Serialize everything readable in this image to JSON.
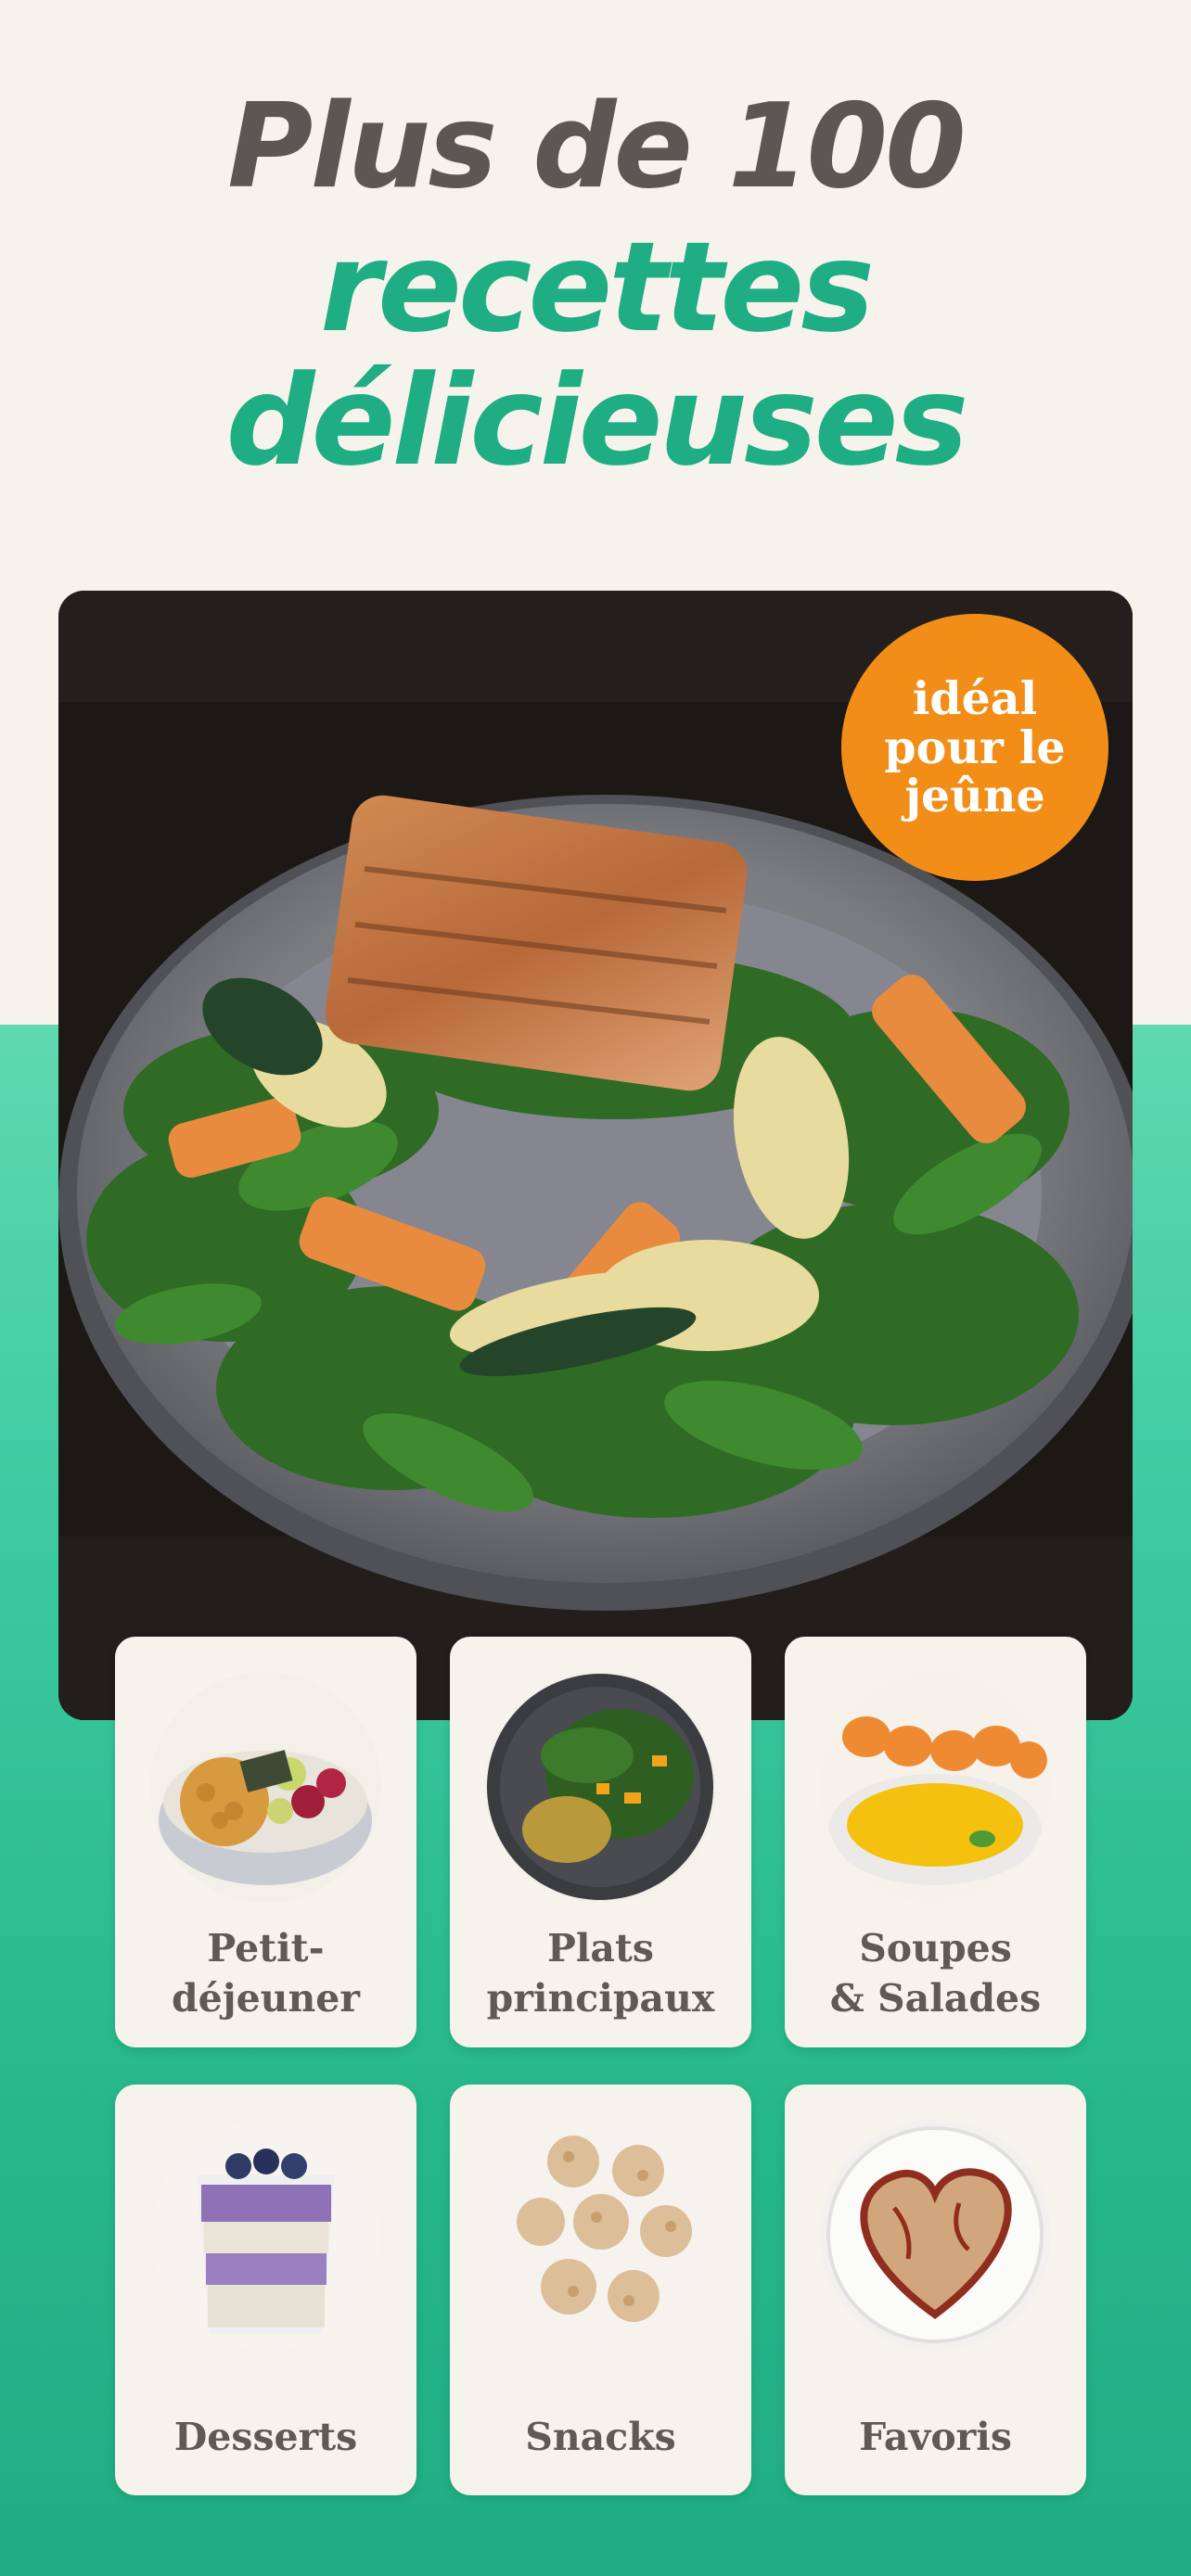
{
  "headline": {
    "line1": "Plus de 100",
    "line2": "recettes",
    "line3": "délicieuses"
  },
  "hero": {
    "image_icon": "salmon-salad-photo",
    "badge": {
      "line1": "idéal",
      "line2": "pour le",
      "line3": "jeûne",
      "color": "#f28e18"
    }
  },
  "categories": [
    {
      "label": "Petit-\ndéjeuner",
      "icon": "breakfast-bowl-photo"
    },
    {
      "label": "Plats\nprincipaux",
      "icon": "main-dish-photo"
    },
    {
      "label": "Soupes\n& Salades",
      "icon": "soup-salad-photo"
    },
    {
      "label": "Desserts",
      "icon": "dessert-photo"
    },
    {
      "label": "Snacks",
      "icon": "snacks-photo"
    },
    {
      "label": "Favoris",
      "icon": "favorites-heart-photo"
    }
  ],
  "colors": {
    "background": "#f6f2ec",
    "accent_green": "#1fad84",
    "headline_gray": "#5b5753",
    "badge_orange": "#f28e18",
    "label_gray": "#5f5a55"
  }
}
